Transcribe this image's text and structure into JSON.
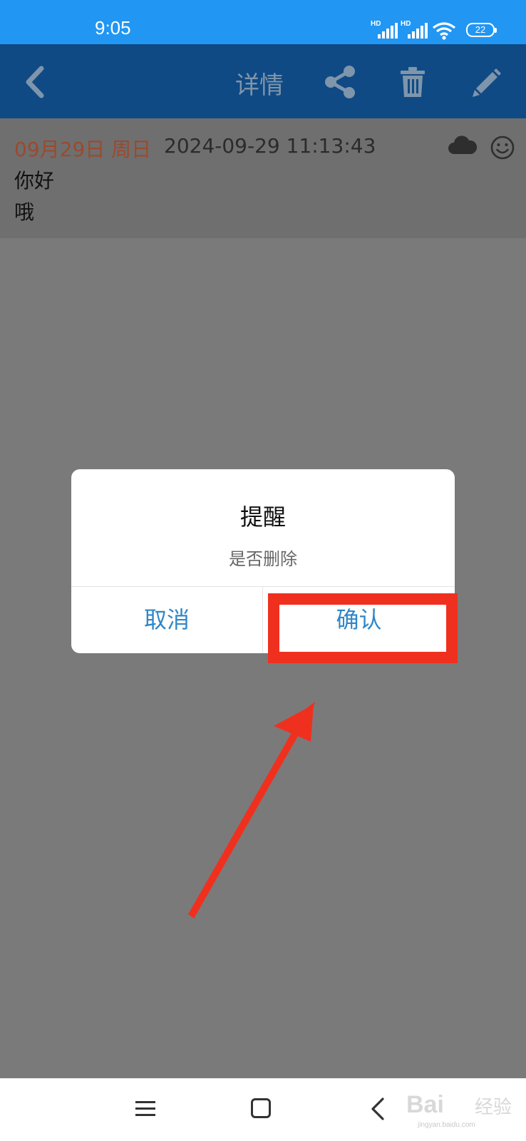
{
  "status_bar": {
    "time": "9:05",
    "signal_badge": "HD",
    "battery_level": "22",
    "icons": [
      "signal-1-icon",
      "signal-2-icon",
      "wifi-icon",
      "battery-icon"
    ]
  },
  "app_bar": {
    "title": "详情",
    "icons": [
      "back-icon",
      "share-icon",
      "trash-icon",
      "edit-icon"
    ]
  },
  "record": {
    "date_label": "09月29日 周日",
    "datetime": "2024-09-29 11:13:43",
    "lines": [
      "你好",
      "哦"
    ],
    "icons": [
      "cloud-icon",
      "smiley-icon"
    ]
  },
  "dialog": {
    "title": "提醒",
    "message": "是否删除",
    "cancel_label": "取消",
    "confirm_label": "确认"
  },
  "nav_bar": {
    "icons": [
      "menu-icon",
      "home-icon",
      "back-nav-icon"
    ]
  },
  "watermark": {
    "brand": "Bai",
    "cn": "经验",
    "url": "jingyan.baidu.com"
  },
  "colors": {
    "status_bar": "#2196f3",
    "app_bar_dimmed": "#0f4a85",
    "overlay": "#7a7a7a",
    "dialog_button": "#2f87c8",
    "annotation_red": "#f0301e"
  }
}
